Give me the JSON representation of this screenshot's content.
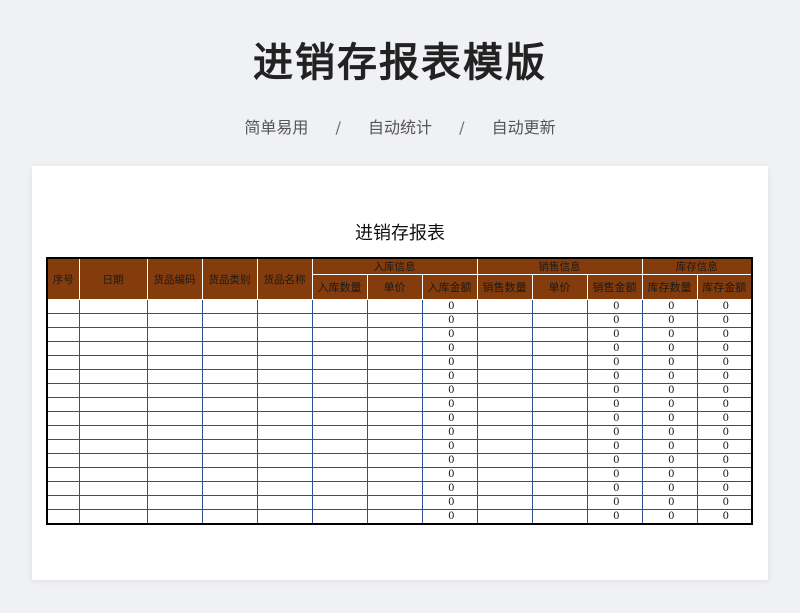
{
  "header": {
    "title": "进销存报表模版",
    "features": [
      "简单易用",
      "自动统计",
      "自动更新"
    ],
    "separator": "/"
  },
  "sheet": {
    "title": "进销存报表",
    "columns": {
      "seq": "序号",
      "date": "日期",
      "code": "货品编码",
      "category": "货品类别",
      "name": "货品名称"
    },
    "groups": {
      "inbound": {
        "label": "入库信息",
        "sub": [
          "入库数量",
          "单价",
          "入库金额"
        ]
      },
      "sales": {
        "label": "销售信息",
        "sub": [
          "销售数量",
          "单价",
          "销售金额"
        ]
      },
      "stock": {
        "label": "库存信息",
        "sub": [
          "库存数量",
          "库存金额"
        ]
      }
    },
    "rows": [
      {
        "inbound_amount": "0",
        "sales_amount": "0",
        "stock_qty": "0",
        "stock_amount": "0"
      },
      {
        "inbound_amount": "0",
        "sales_amount": "0",
        "stock_qty": "0",
        "stock_amount": "0"
      },
      {
        "inbound_amount": "0",
        "sales_amount": "0",
        "stock_qty": "0",
        "stock_amount": "0"
      },
      {
        "inbound_amount": "0",
        "sales_amount": "0",
        "stock_qty": "0",
        "stock_amount": "0"
      },
      {
        "inbound_amount": "0",
        "sales_amount": "0",
        "stock_qty": "0",
        "stock_amount": "0"
      },
      {
        "inbound_amount": "0",
        "sales_amount": "0",
        "stock_qty": "0",
        "stock_amount": "0"
      },
      {
        "inbound_amount": "0",
        "sales_amount": "0",
        "stock_qty": "0",
        "stock_amount": "0"
      },
      {
        "inbound_amount": "0",
        "sales_amount": "0",
        "stock_qty": "0",
        "stock_amount": "0"
      },
      {
        "inbound_amount": "0",
        "sales_amount": "0",
        "stock_qty": "0",
        "stock_amount": "0"
      },
      {
        "inbound_amount": "0",
        "sales_amount": "0",
        "stock_qty": "0",
        "stock_amount": "0"
      },
      {
        "inbound_amount": "0",
        "sales_amount": "0",
        "stock_qty": "0",
        "stock_amount": "0"
      },
      {
        "inbound_amount": "0",
        "sales_amount": "0",
        "stock_qty": "0",
        "stock_amount": "0"
      },
      {
        "inbound_amount": "0",
        "sales_amount": "0",
        "stock_qty": "0",
        "stock_amount": "0"
      },
      {
        "inbound_amount": "0",
        "sales_amount": "0",
        "stock_qty": "0",
        "stock_amount": "0"
      },
      {
        "inbound_amount": "0",
        "sales_amount": "0",
        "stock_qty": "0",
        "stock_amount": "0"
      },
      {
        "inbound_amount": "0",
        "sales_amount": "0",
        "stock_qty": "0",
        "stock_amount": "0"
      }
    ]
  },
  "colors": {
    "header_fill": "#843c0c",
    "grid_line": "#2f4f8f",
    "background": "#f0f1f4"
  }
}
